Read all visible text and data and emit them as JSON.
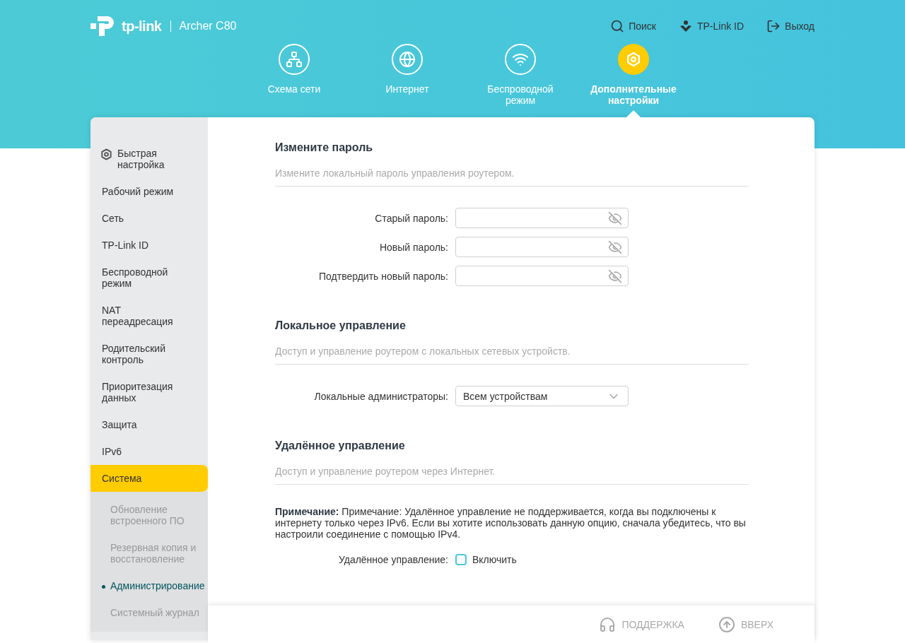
{
  "header": {
    "brand": "tp-link",
    "model": "Archer C80",
    "actions": [
      {
        "kind": "search",
        "label": "Поиск"
      },
      {
        "kind": "id",
        "label": "TP-Link ID"
      },
      {
        "kind": "logout",
        "label": "Выход"
      }
    ]
  },
  "tabs": [
    {
      "kind": "network",
      "label": "Схема сети",
      "selected": false
    },
    {
      "kind": "internet",
      "label": "Интернет",
      "selected": false
    },
    {
      "kind": "wireless",
      "label": "Беспроводной режим",
      "selected": false
    },
    {
      "kind": "advanced",
      "label": "Дополнительные настройки",
      "selected": true
    }
  ],
  "sidebar": {
    "items": [
      {
        "label": "Быстрая настройка",
        "kind": "quick",
        "selected": false
      },
      {
        "label": "Рабочий режим",
        "selected": false
      },
      {
        "label": "Сеть",
        "selected": false
      },
      {
        "label": "TP-Link ID",
        "selected": false
      },
      {
        "label": "Беспроводной режим",
        "selected": false
      },
      {
        "label": "NAT переадресация",
        "selected": false
      },
      {
        "label": "Родительский контроль",
        "selected": false
      },
      {
        "label": "Приоритезация данных",
        "selected": false
      },
      {
        "label": "Защита",
        "selected": false
      },
      {
        "label": "IPv6",
        "selected": false
      },
      {
        "label": "Система",
        "selected": true,
        "children": [
          {
            "label": "Обновление встроенного ПО",
            "selected": false
          },
          {
            "label": "Резервная копия и восстановление",
            "selected": false
          },
          {
            "label": "Администрирование",
            "selected": true
          },
          {
            "label": "Системный журнал",
            "selected": false
          }
        ]
      }
    ]
  },
  "sections": [
    {
      "title": "Измените пароль",
      "description": "Измените локальный пароль управления роутером.",
      "rows": [
        {
          "kind": "password",
          "label": "Старый пароль:"
        },
        {
          "kind": "password",
          "label": "Новый пароль:"
        },
        {
          "kind": "password",
          "label": "Подтвердить новый пароль:"
        }
      ]
    },
    {
      "title": "Локальное управление",
      "description": "Доступ и управление роутером с локальных сетевых устройств.",
      "rows": [
        {
          "kind": "select",
          "label": "Локальные администраторы:",
          "value": "Всем устройствам"
        }
      ]
    },
    {
      "title": "Удалённое управление",
      "description": "Доступ и управление роутером через Интернет.",
      "note": "**Примечание:** Примечание: Удалённое управление не поддерживается, когда вы подключены к интернету только через IPv6. Если вы хотите использовать данную опцию, сначала убедитесь, что вы настроили соединение с помощью IPv4.",
      "rows": [
        {
          "kind": "checkbox",
          "label": "Удалённое управление:",
          "option": "Включить",
          "checked": false
        }
      ]
    }
  ],
  "footer": [
    {
      "kind": "support",
      "label": "ПОДДЕРЖКА"
    },
    {
      "kind": "top",
      "label": "ВВЕРХ"
    }
  ]
}
